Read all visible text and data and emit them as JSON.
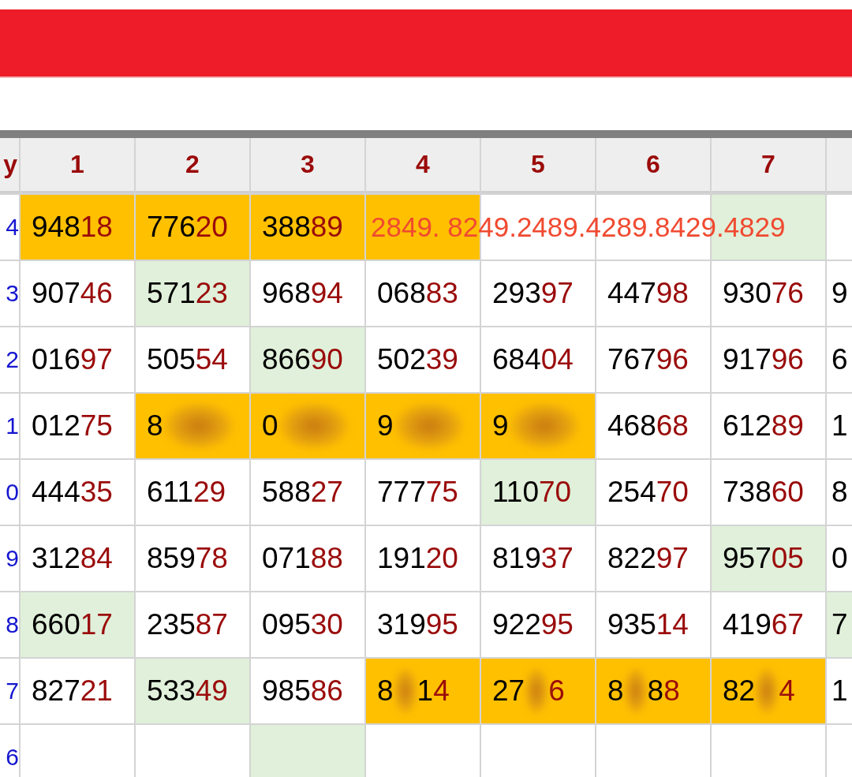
{
  "header_columns": [
    {
      "label": "y"
    },
    {
      "label": "1"
    },
    {
      "label": "2"
    },
    {
      "label": "3"
    },
    {
      "label": "4"
    },
    {
      "label": "5"
    },
    {
      "label": "6"
    },
    {
      "label": "7"
    },
    {}
  ],
  "rows": [
    {
      "label": "4",
      "cells": [
        {
          "kind": "number",
          "text": "94818",
          "color": "#ffc000"
        },
        {
          "kind": "number",
          "text": "77620",
          "color": "#ffc000"
        },
        {
          "kind": "number",
          "text": "38889",
          "color": "#ffc000"
        },
        {
          "kind": "overflow",
          "text": "2849. 8249.2489.4289.8429.4829",
          "color": "#ffc000"
        },
        {
          "kind": "empty"
        },
        {
          "kind": "empty"
        },
        {
          "kind": "empty",
          "color": "#e0f0da"
        },
        {
          "kind": "empty"
        }
      ]
    },
    {
      "label": "3",
      "cells": [
        {
          "kind": "number",
          "text": "90746"
        },
        {
          "kind": "number",
          "text": "57123",
          "color": "#e0f0da"
        },
        {
          "kind": "number",
          "text": "96894"
        },
        {
          "kind": "number",
          "text": "06883"
        },
        {
          "kind": "number",
          "text": "29397"
        },
        {
          "kind": "number",
          "text": "44798"
        },
        {
          "kind": "number",
          "text": "93076"
        },
        {
          "kind": "number",
          "text": "9"
        }
      ]
    },
    {
      "label": "2",
      "cells": [
        {
          "kind": "number",
          "text": "01697"
        },
        {
          "kind": "number",
          "text": "50554"
        },
        {
          "kind": "number",
          "text": "86690",
          "color": "#e0f0da"
        },
        {
          "kind": "number",
          "text": "50239"
        },
        {
          "kind": "number",
          "text": "68404"
        },
        {
          "kind": "number",
          "text": "76796"
        },
        {
          "kind": "number",
          "text": "91796"
        },
        {
          "kind": "number",
          "text": "6"
        }
      ]
    },
    {
      "label": "1",
      "cells": [
        {
          "kind": "number",
          "text": "01275"
        },
        {
          "kind": "blurred",
          "text": "8",
          "color": "#ffc000"
        },
        {
          "kind": "blurred",
          "text": "0",
          "color": "#ffc000"
        },
        {
          "kind": "blurred",
          "text": "9",
          "color": "#ffc000"
        },
        {
          "kind": "blurred",
          "text": "9",
          "color": "#ffc000"
        },
        {
          "kind": "number",
          "text": "46868"
        },
        {
          "kind": "number",
          "text": "61289"
        },
        {
          "kind": "number",
          "text": "1"
        }
      ]
    },
    {
      "label": "0",
      "cells": [
        {
          "kind": "number",
          "text": "44435"
        },
        {
          "kind": "number",
          "text": "61129"
        },
        {
          "kind": "number",
          "text": "58827"
        },
        {
          "kind": "number",
          "text": "77775"
        },
        {
          "kind": "number",
          "text": "11070",
          "color": "#e0f0da"
        },
        {
          "kind": "number",
          "text": "25470"
        },
        {
          "kind": "number",
          "text": "73860"
        },
        {
          "kind": "number",
          "text": "8"
        }
      ]
    },
    {
      "label": "9",
      "cells": [
        {
          "kind": "number",
          "text": "31284"
        },
        {
          "kind": "number",
          "text": "85978"
        },
        {
          "kind": "number",
          "text": "07188"
        },
        {
          "kind": "number",
          "text": "19120"
        },
        {
          "kind": "number",
          "text": "81937"
        },
        {
          "kind": "number",
          "text": "82297"
        },
        {
          "kind": "number",
          "text": "95705",
          "color": "#e0f0da"
        },
        {
          "kind": "number",
          "text": "0"
        }
      ]
    },
    {
      "label": "8",
      "cells": [
        {
          "kind": "number",
          "text": "66017",
          "color": "#e0f0da"
        },
        {
          "kind": "number",
          "text": "23587"
        },
        {
          "kind": "number",
          "text": "09530"
        },
        {
          "kind": "number",
          "text": "31995"
        },
        {
          "kind": "number",
          "text": "92295"
        },
        {
          "kind": "number",
          "text": "93514"
        },
        {
          "kind": "number",
          "text": "41967"
        },
        {
          "kind": "number",
          "text": "7",
          "color": "#e0f0da"
        }
      ]
    },
    {
      "label": "7",
      "cells": [
        {
          "kind": "number",
          "text": "82721"
        },
        {
          "kind": "number",
          "text": "53349",
          "color": "#e0f0da"
        },
        {
          "kind": "number",
          "text": "98586"
        },
        {
          "kind": "blurred",
          "text": "8 14",
          "color": "#ffc000"
        },
        {
          "kind": "blurred",
          "text": "27 6",
          "color": "#ffc000"
        },
        {
          "kind": "blurred",
          "text": "8 88",
          "color": "#ffc000"
        },
        {
          "kind": "blurred",
          "text": "82 4",
          "color": "#ffc000"
        },
        {
          "kind": "number",
          "text": "1"
        }
      ]
    },
    {
      "label": "6",
      "cells": [
        {
          "kind": "empty"
        },
        {
          "kind": "empty"
        },
        {
          "kind": "empty",
          "color": "#e0f0da"
        },
        {
          "kind": "empty"
        },
        {
          "kind": "empty"
        },
        {
          "kind": "empty"
        },
        {
          "kind": "empty"
        },
        {
          "kind": "empty"
        }
      ]
    }
  ]
}
